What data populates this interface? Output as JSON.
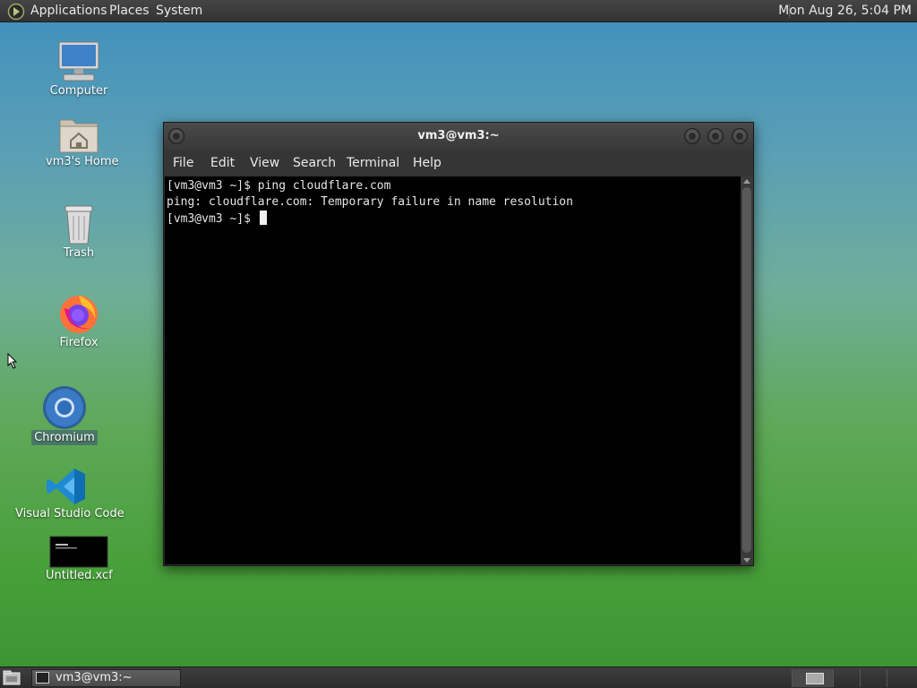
{
  "top_panel": {
    "menus": [
      "Applications",
      "Places",
      "System"
    ],
    "clock": "Mon Aug 26,  5:04 PM"
  },
  "desktop_icons": {
    "computer": {
      "label": "Computer",
      "icon": "computer-icon"
    },
    "home": {
      "label": "vm3's Home",
      "icon": "home-folder-icon"
    },
    "trash": {
      "label": "Trash",
      "icon": "trash-icon"
    },
    "firefox": {
      "label": "Firefox",
      "icon": "firefox-icon"
    },
    "chromium": {
      "label": "Chromium",
      "icon": "chromium-icon",
      "selected": true
    },
    "vscode": {
      "label": "Visual Studio Code",
      "icon": "vscode-icon"
    },
    "xcf": {
      "label": "Untitled.xcf",
      "icon": "xcf-thumbnail-icon"
    }
  },
  "terminal": {
    "title": "vm3@vm3:~",
    "menu": [
      "File",
      "Edit",
      "View",
      "Search",
      "Terminal",
      "Help"
    ],
    "lines": [
      "[vm3@vm3 ~]$ ping cloudflare.com",
      "ping: cloudflare.com: Temporary failure in name resolution",
      "[vm3@vm3 ~]$ "
    ]
  },
  "taskbar": {
    "task_label": "vm3@vm3:~",
    "workspaces": 4,
    "active_workspace": 1
  },
  "colors": {
    "panel": "#383838",
    "terminal_bg": "#000000",
    "terminal_fg": "#e6e6e6",
    "desktop_top": "#3f8fbd",
    "desktop_bottom": "#3a9331"
  }
}
